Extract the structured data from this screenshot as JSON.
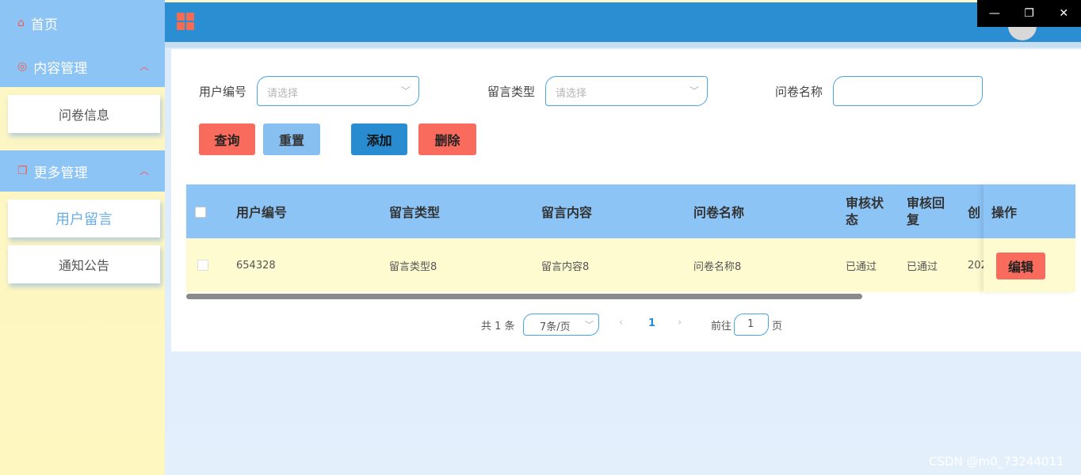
{
  "sidebar": {
    "home": "首页",
    "content_group": "内容管理",
    "content_items": [
      "问卷信息"
    ],
    "more_group": "更多管理",
    "more_items": [
      "用户留言",
      "通知公告"
    ]
  },
  "window_controls": {
    "minimize": "—",
    "restore": "❐",
    "close": "✕"
  },
  "filters": {
    "user_label": "用户编号",
    "user_placeholder": "请选择",
    "type_label": "留言类型",
    "type_placeholder": "请选择",
    "survey_label": "问卷名称",
    "survey_value": ""
  },
  "buttons": {
    "query": "查询",
    "reset": "重置",
    "add": "添加",
    "delete": "删除"
  },
  "table": {
    "headers": {
      "user": "用户编号",
      "type": "留言类型",
      "content": "留言内容",
      "survey": "问卷名称",
      "status_l1": "审核状",
      "status_l2": "态",
      "reply_l1": "审核回",
      "reply_l2": "复",
      "created": "创",
      "op": "操作"
    },
    "rows": [
      {
        "user": "654328",
        "type": "留言类型8",
        "content": "留言内容8",
        "survey": "问卷名称8",
        "status": "已通过",
        "reply": "已通过",
        "created": "202",
        "edit": "编辑"
      }
    ]
  },
  "pagination": {
    "total": "共 1 条",
    "page_size": "7条/页",
    "prev": "‹",
    "current": "1",
    "next": "›",
    "goto_label": "前往",
    "goto_value": "1",
    "goto_suffix": "页"
  },
  "watermark": "CSDN @m0_73244011",
  "colors": {
    "header": "#2b8ed3",
    "accent_red": "#f96b5c",
    "light_blue": "#8cc4f6",
    "row_bg": "#fefbd0"
  }
}
